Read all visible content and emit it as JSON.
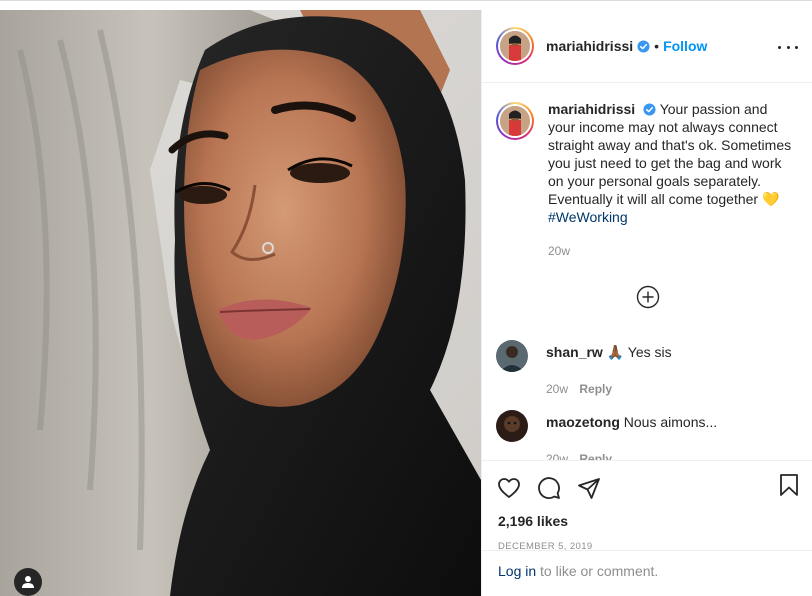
{
  "post": {
    "username": "mariahidrissi",
    "verified": true,
    "separator": "•",
    "follow_label": "Follow",
    "more_icon": "more-options-icon"
  },
  "caption": {
    "username": "mariahidrissi",
    "text": "Your passion and your income may not always connect straight away and that's ok. Sometimes you just need to get the bag and work on your personal goals separately. Eventually it will all come together",
    "emoji": "💛",
    "hashtag": "#WeWorking",
    "time": "20w"
  },
  "comments": [
    {
      "username": "shan_rw",
      "text": "🙏🏾 Yes sis",
      "time": "20w",
      "reply_label": "Reply"
    },
    {
      "username": "maozetong",
      "text": "Nous aimons...",
      "time": "20w",
      "reply_label": "Reply"
    }
  ],
  "actions": {
    "icons": [
      "heart-icon",
      "comment-icon",
      "share-icon",
      "bookmark-icon"
    ],
    "likes": "2,196 likes",
    "date": "DECEMBER 5, 2019"
  },
  "login": {
    "link_label": "Log in",
    "rest": " to like or comment."
  },
  "colors": {
    "accent": "#0095f6",
    "hashtag": "#00376b",
    "muted": "#8e8e8e",
    "text": "#262626"
  }
}
